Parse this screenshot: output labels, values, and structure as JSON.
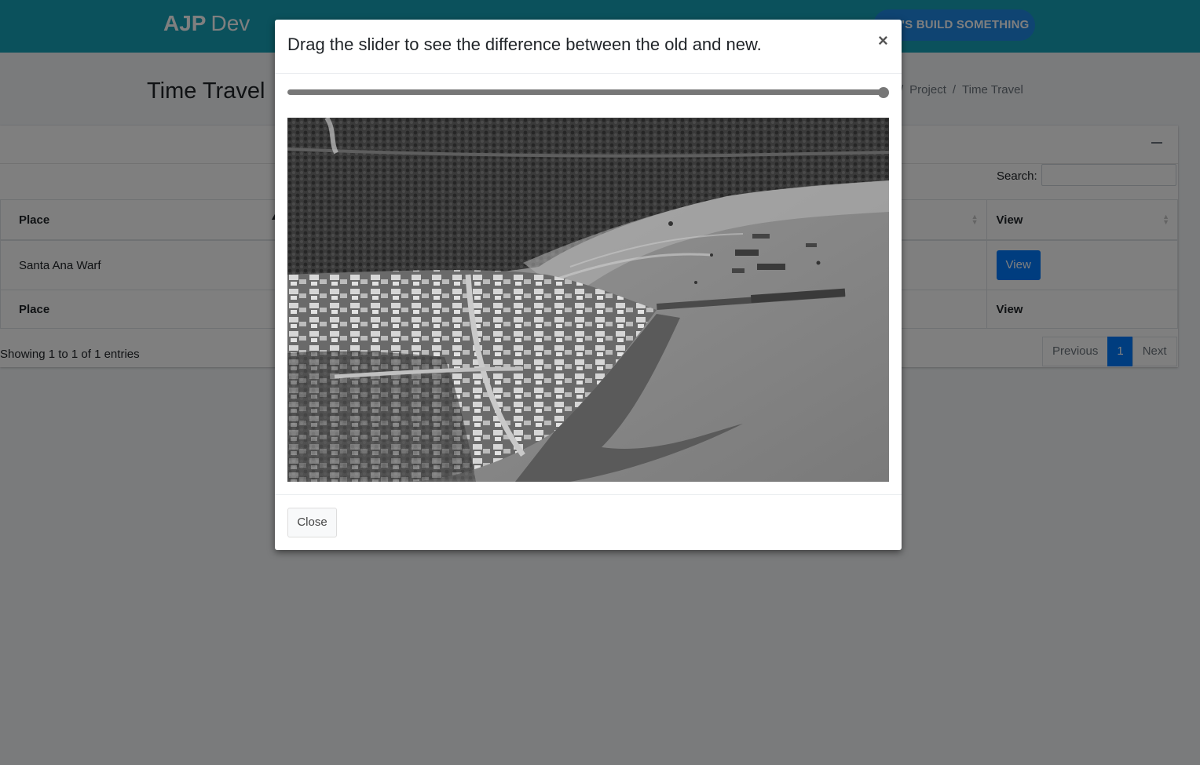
{
  "navbar": {
    "brand_bold": "AJP",
    "brand_light": "Dev",
    "cta_label": "LET'S BUILD SOMETHING"
  },
  "page": {
    "title": "Time Travel",
    "breadcrumb": [
      "Project",
      "Time Travel"
    ]
  },
  "table": {
    "search_label": "Search:",
    "search_value": "",
    "columns": [
      "Place",
      "",
      "View"
    ],
    "rows": [
      {
        "place": "Santa Ana Warf",
        "view_label": "View"
      }
    ],
    "footer_columns": [
      "Place",
      "",
      "View"
    ],
    "info": "Showing 1 to 1 of 1 entries",
    "pagination": {
      "previous": "Previous",
      "current": "1",
      "next": "Next"
    }
  },
  "modal": {
    "title": "Drag the slider to see the difference between the old and new.",
    "close_symbol": "×",
    "slider_value_percent": 100,
    "close_label": "Close"
  },
  "colors": {
    "navbar": "#17a2b8",
    "primary": "#007bff",
    "overlay": "rgba(0,0,0,0.5)",
    "slider": "#777777"
  }
}
